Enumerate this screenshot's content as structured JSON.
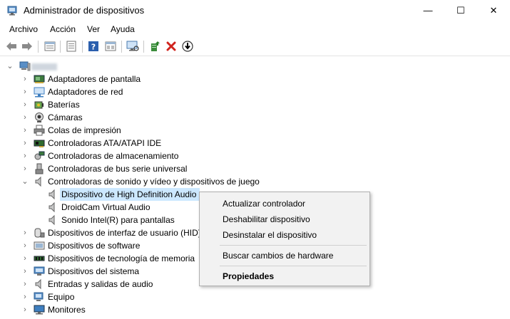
{
  "window": {
    "title": "Administrador de dispositivos",
    "minimize_glyph": "—",
    "maximize_glyph": "☐",
    "close_glyph": "✕"
  },
  "menu": {
    "items": [
      {
        "label": "Archivo"
      },
      {
        "label": "Acción"
      },
      {
        "label": "Ver"
      },
      {
        "label": "Ayuda"
      }
    ]
  },
  "toolbar": {
    "icons": [
      "back-icon",
      "forward-icon",
      "properties-icon",
      "view-icon",
      "help-icon",
      "view-grid-icon",
      "monitor-scan-icon",
      "update-driver-icon",
      "uninstall-icon",
      "download-icon"
    ],
    "accent_red": "#d0231d"
  },
  "tree": {
    "root": {
      "label": ""
    },
    "categories": [
      {
        "label": "Adaptadores de pantalla",
        "icon": "display-adapter-icon"
      },
      {
        "label": "Adaptadores de red",
        "icon": "network-adapter-icon"
      },
      {
        "label": "Baterías",
        "icon": "battery-icon"
      },
      {
        "label": "Cámaras",
        "icon": "camera-icon"
      },
      {
        "label": "Colas de impresión",
        "icon": "printer-icon"
      },
      {
        "label": "Controladoras ATA/ATAPI IDE",
        "icon": "ide-controller-icon"
      },
      {
        "label": "Controladoras de almacenamiento",
        "icon": "storage-controller-icon"
      },
      {
        "label": "Controladoras de bus serie universal",
        "icon": "usb-icon"
      },
      {
        "label": "Controladoras de sonido y vídeo y dispositivos de juego",
        "icon": "speaker-icon",
        "expanded": true,
        "children": [
          {
            "label": "Dispositivo de High Definition Audio",
            "icon": "speaker-icon",
            "selected": true
          },
          {
            "label": "DroidCam Virtual Audio",
            "icon": "speaker-icon"
          },
          {
            "label": "Sonido Intel(R) para pantallas",
            "icon": "speaker-icon"
          }
        ]
      },
      {
        "label": "Dispositivos de interfaz de usuario (HID)",
        "icon": "hid-icon"
      },
      {
        "label": "Dispositivos de software",
        "icon": "software-device-icon"
      },
      {
        "label": "Dispositivos de tecnología de memoria",
        "icon": "memory-icon"
      },
      {
        "label": "Dispositivos del sistema",
        "icon": "system-device-icon"
      },
      {
        "label": "Entradas y salidas de audio",
        "icon": "audio-io-icon"
      },
      {
        "label": "Equipo",
        "icon": "computer-icon"
      },
      {
        "label": "Monitores",
        "icon": "monitor-icon"
      }
    ]
  },
  "context_menu": {
    "items": [
      {
        "label": "Actualizar controlador"
      },
      {
        "label": "Deshabilitar dispositivo"
      },
      {
        "label": "Desinstalar el dispositivo"
      },
      {
        "label": "Buscar cambios de hardware"
      },
      {
        "label": "Propiedades"
      }
    ]
  }
}
